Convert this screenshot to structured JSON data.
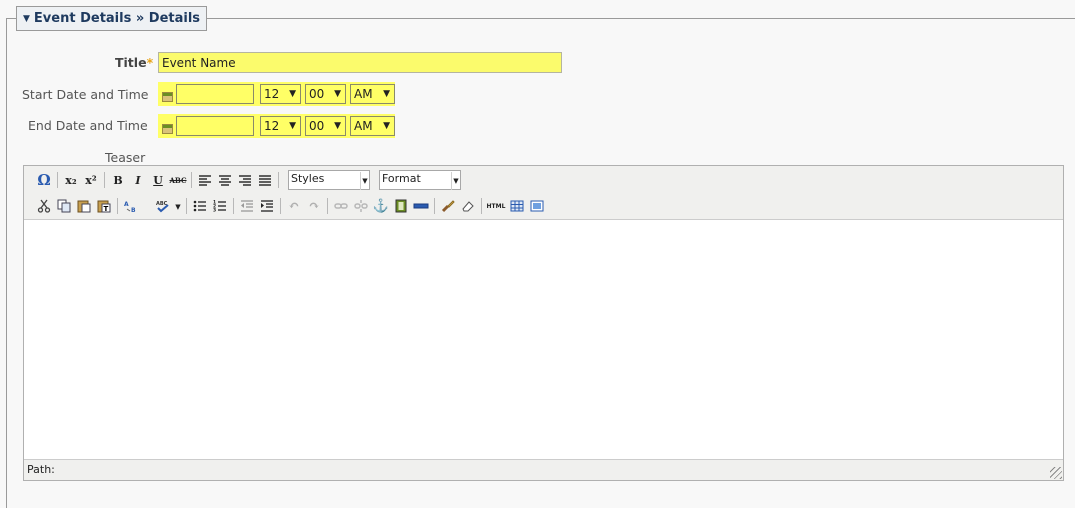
{
  "legend": {
    "toggle_icon": "triangle-down",
    "text": "Event Details » Details"
  },
  "title_field": {
    "label": "Title",
    "required_mark": "*",
    "value": "Event Name"
  },
  "start": {
    "label": "Start Date and Time",
    "date_value": "",
    "hour": "12",
    "minute": "00",
    "ampm": "AM",
    "calendar_icon": "calendar-icon"
  },
  "end": {
    "label": "End Date and Time",
    "date_value": "",
    "hour": "12",
    "minute": "00",
    "ampm": "AM",
    "calendar_icon": "calendar-icon"
  },
  "teaser": {
    "label": "Teaser",
    "styles_dropdown": "Styles",
    "format_dropdown": "Format",
    "status_path_label": "Path:",
    "toolbar_row1": {
      "omega": "Ω",
      "subscript": "x₂",
      "superscript": "x²",
      "bold": "B",
      "italic": "I",
      "underline": "U",
      "strike": "ABC"
    },
    "toolbar_row2": {
      "html": "HTML"
    }
  },
  "colors": {
    "field_highlight": "#ffff66",
    "required": "#e8a317",
    "legend_text": "#1e3a5f"
  }
}
